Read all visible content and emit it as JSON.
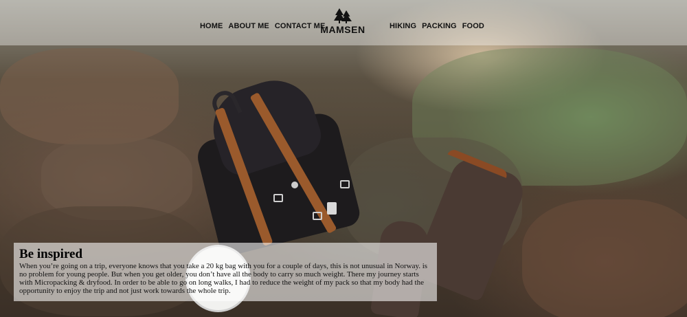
{
  "header": {
    "nav_left": [
      "HOME",
      "ABOUT ME",
      "CONTACT ME"
    ],
    "logo_text": "MAMSEN",
    "logo_icon": "pine-trees-icon",
    "nav_right": [
      "HIKING",
      "PACKING",
      "FOOD"
    ]
  },
  "hero": {
    "card": {
      "title": "Be inspired",
      "body": "When you’re going on a trip, everyone knows that you take a 20 kg bag with you for a couple of days, this is not unusual in Norway. is no problem for young people. But when you get older, you don’t have all the body to carry so much weight. There my journey starts with Micropacking & dryfood. In order to be able to go on long walks, I had to reduce the weight of my pack so that my body had the opportunity to enjoy the trip and not just work towards the whole trip."
    }
  },
  "colors": {
    "header_bg": "rgba(255,255,255,0.38)",
    "nav_text": "#111111",
    "card_bg": "rgba(255,255,255,0.58)"
  }
}
